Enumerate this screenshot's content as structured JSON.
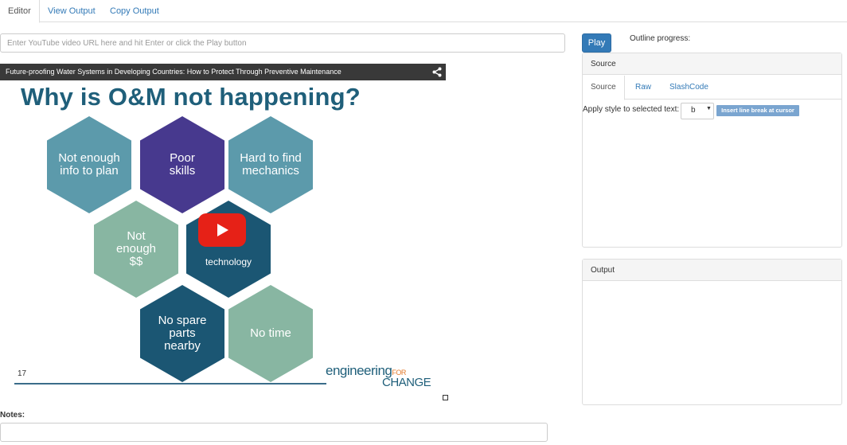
{
  "tabs": [
    {
      "label": "Editor",
      "active": true
    },
    {
      "label": "View Output",
      "active": false
    },
    {
      "label": "Copy Output",
      "active": false
    }
  ],
  "url_input": {
    "placeholder": "Enter YouTube video URL here and hit Enter or click the Play button",
    "value": ""
  },
  "video": {
    "title": "Future-proofing Water Systems in Developing Countries: How to Protect Through Preventive Maintenance",
    "slide_title": "Why is O&M not happening?",
    "hexagons": [
      {
        "text": "Not enough\ninfo to plan"
      },
      {
        "text": "Poor\nskills"
      },
      {
        "text": "Hard to find\nmechanics"
      },
      {
        "text": "Not\nenough\n$$"
      },
      {
        "text": "technology"
      },
      {
        "text": "No spare\nparts\nnearby"
      },
      {
        "text": "No time"
      }
    ],
    "slide_number": "17",
    "brand_line1": "engineering",
    "brand_for": "FOR",
    "brand_line2": "CHANGE",
    "icons": {
      "share": "share-icon",
      "play": "youtube-play-icon"
    },
    "colors": {
      "teal": "#5c9aab",
      "purple": "#47398e",
      "sage": "#88b6a2",
      "navy": "#1b5673",
      "play_red": "#e62117"
    }
  },
  "notes": {
    "label": "Notes:",
    "value": ""
  },
  "play_button": {
    "label": "Play"
  },
  "outline_progress_label": "Outline progress:",
  "source_panel": {
    "heading": "Source",
    "tabs": [
      {
        "label": "Source",
        "active": true
      },
      {
        "label": "Raw",
        "active": false
      },
      {
        "label": "SlashCode",
        "active": false
      }
    ],
    "style_label": "Apply style to selected text:",
    "style_selected": "b",
    "line_break_button": "Insert line break at cursor"
  },
  "output_panel": {
    "heading": "Output"
  }
}
